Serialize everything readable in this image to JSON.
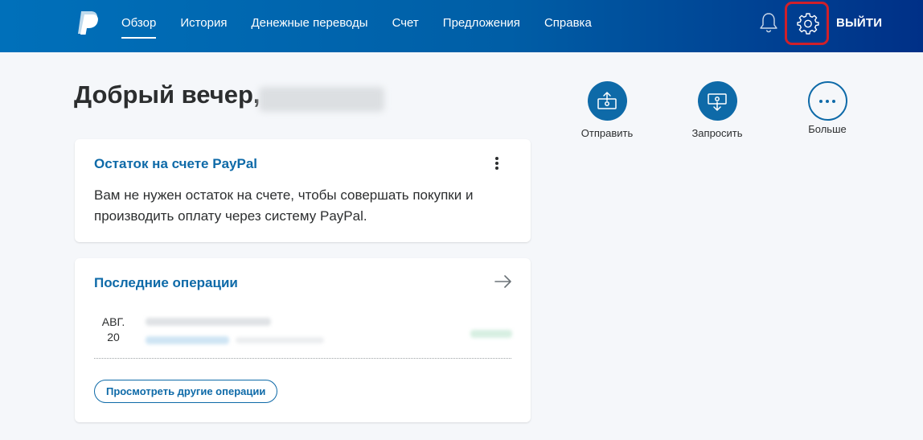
{
  "header": {
    "nav": [
      "Обзор",
      "История",
      "Денежные переводы",
      "Счет",
      "Предложения",
      "Справка"
    ],
    "active_index": 0,
    "logout_label": "ВЫЙТИ"
  },
  "greeting": {
    "text": "Добрый вечер,"
  },
  "balance_card": {
    "title": "Остаток на счете PayPal",
    "text": "Вам не нужен остаток на счете, чтобы совершать покупки и производить оплату через систему PayPal."
  },
  "transactions_card": {
    "title": "Последние операции",
    "items": [
      {
        "month": "АВГ.",
        "day": "20"
      }
    ],
    "more_label": "Просмотреть другие операции"
  },
  "actions": [
    {
      "label": "Отправить",
      "icon": "send-money-icon"
    },
    {
      "label": "Запросить",
      "icon": "request-money-icon"
    },
    {
      "label": "Больше",
      "icon": "more-icon"
    }
  ],
  "colors": {
    "header_start": "#0070ba",
    "header_end": "#003087",
    "accent": "#0e6aa8",
    "highlight_border": "#d0202a",
    "background": "#f5f7fa"
  }
}
